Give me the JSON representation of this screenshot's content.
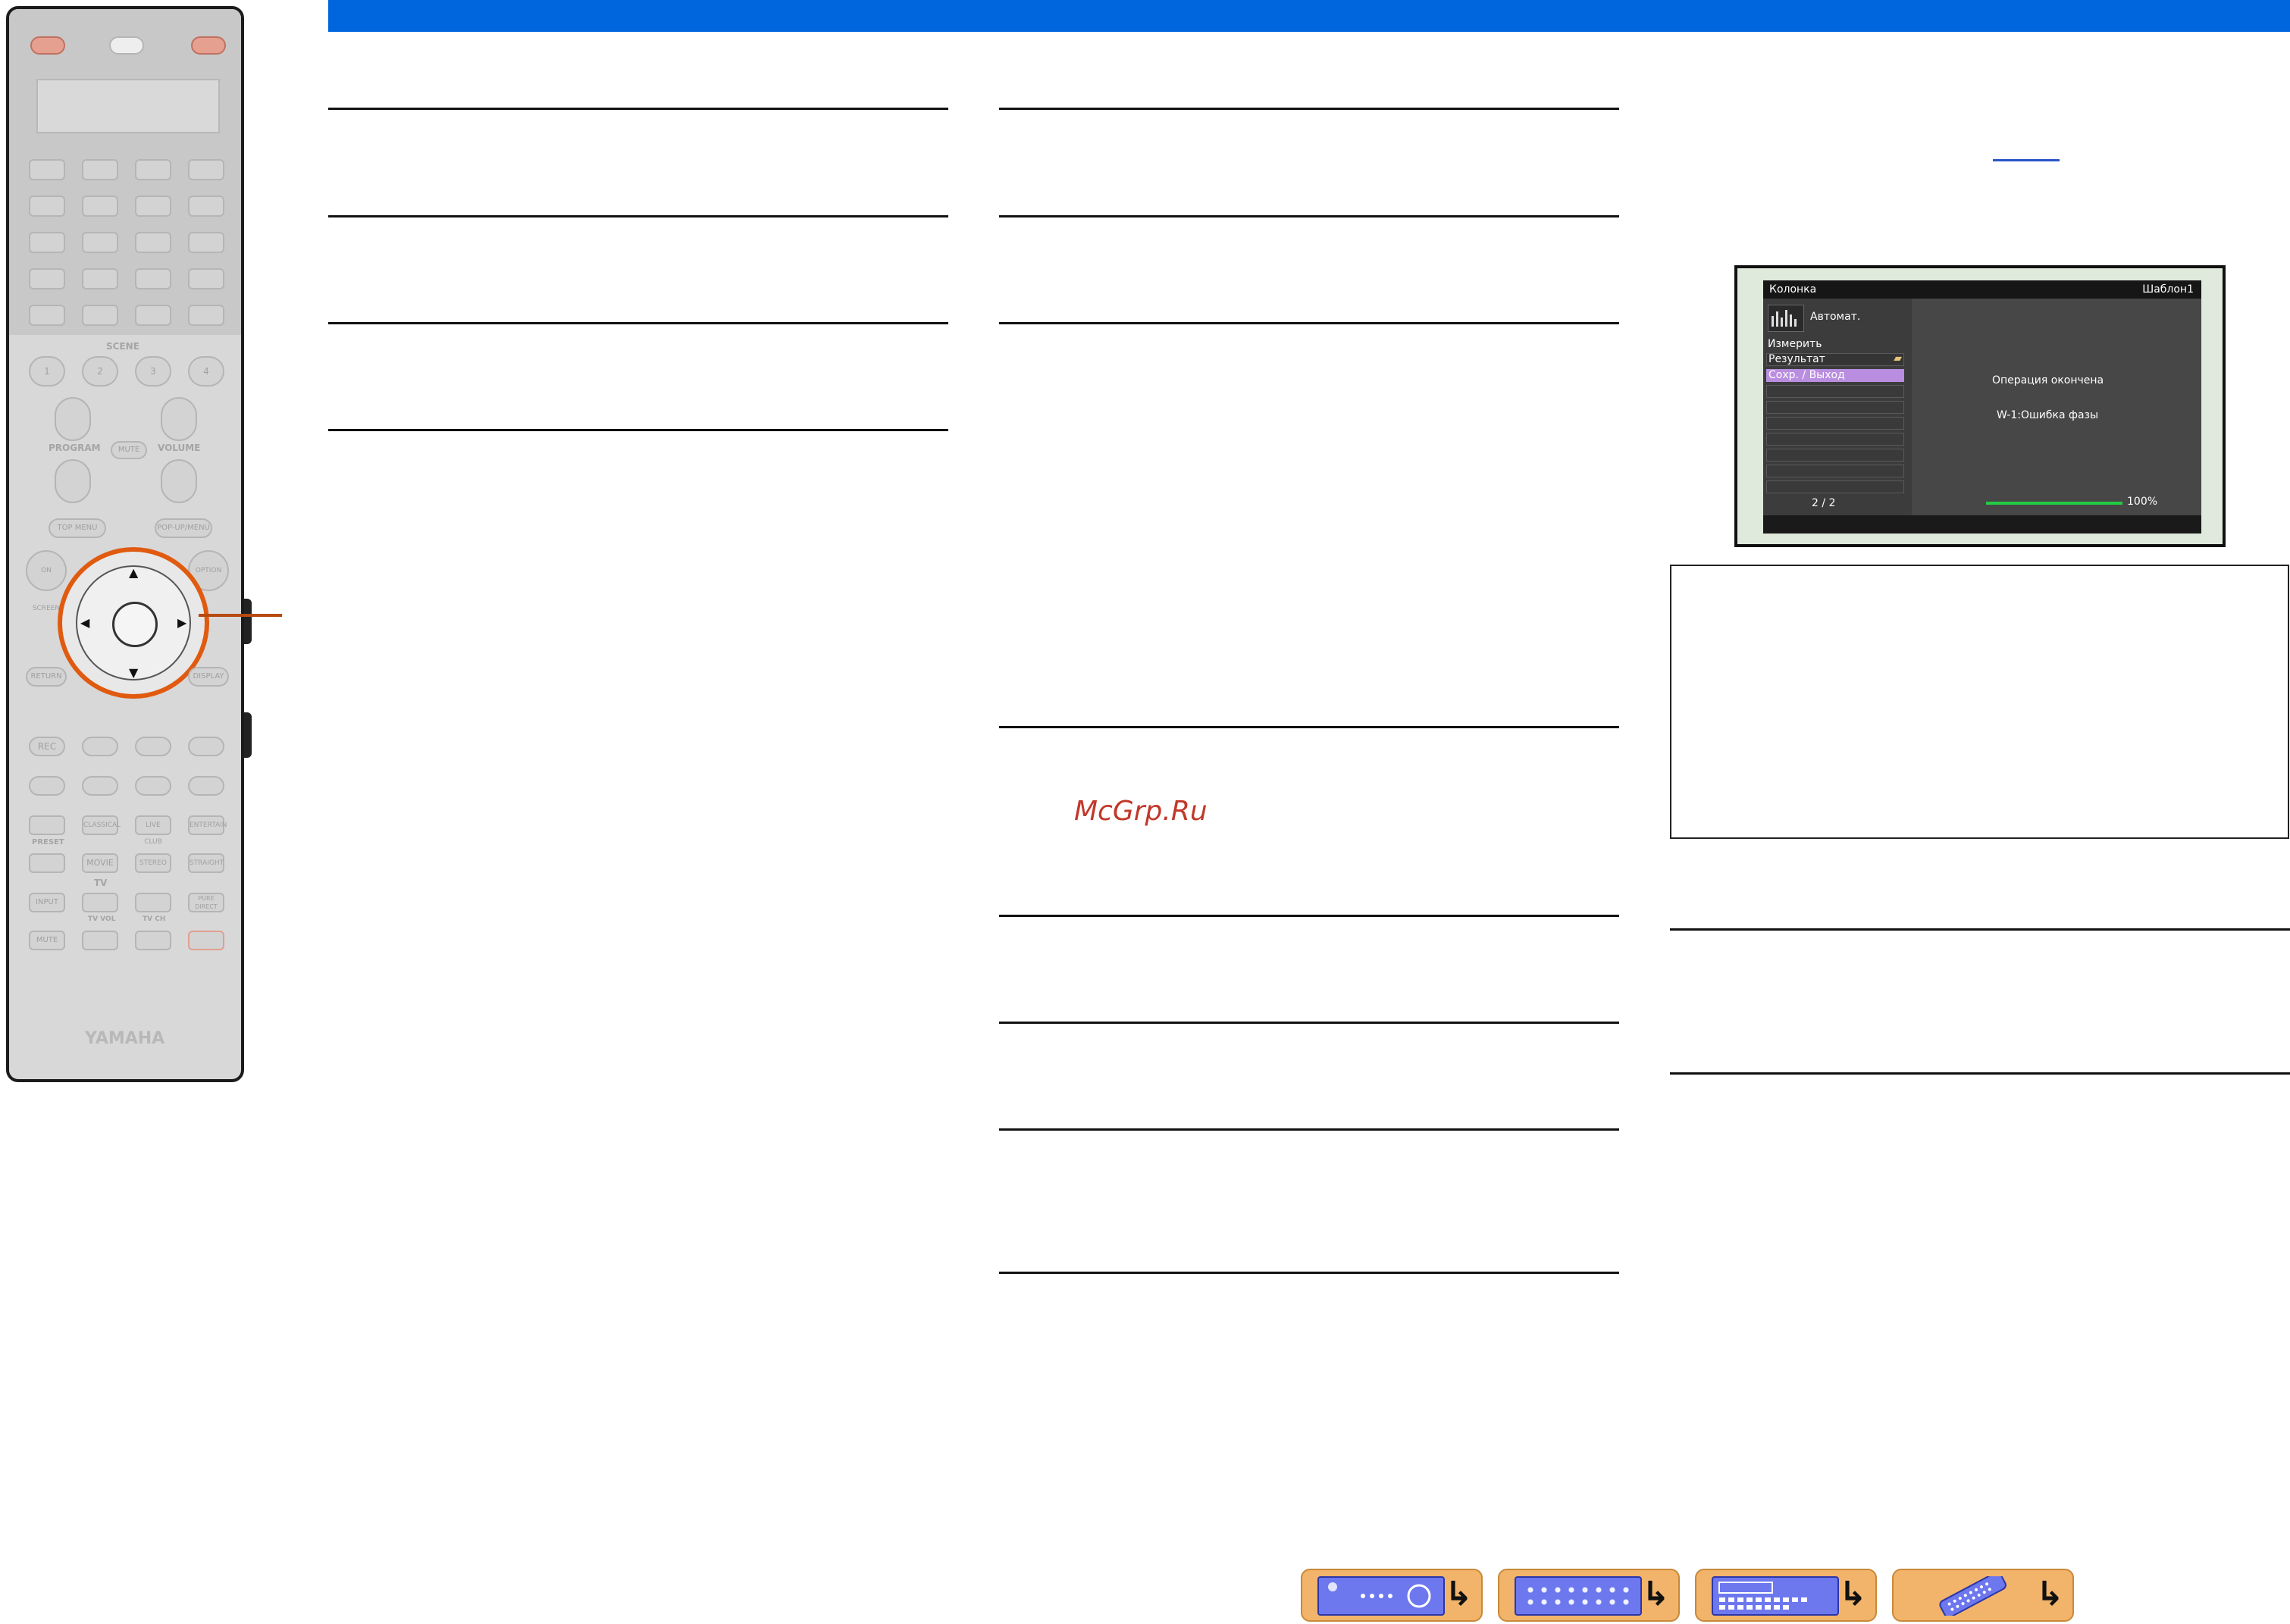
{
  "remote": {
    "scene_label": "SCENE",
    "scene_buttons": [
      "1",
      "2",
      "3",
      "4"
    ],
    "program_label": "PROGRAM",
    "volume_label": "VOLUME",
    "mute_small": "MUTE",
    "top_menu": "TOP MENU",
    "popup_menu": "POP-UP/MENU",
    "on_screen": "ON SCREEN",
    "option": "OPTION",
    "return": "RETURN",
    "display": "DISPLAY",
    "rec": "REC",
    "preset": "PRESET",
    "classical": "CLASSICAL",
    "live_club": "LIVE CLUB",
    "entertain": "ENTERTAIN",
    "movie": "MOVIE",
    "stereo": "STEREO",
    "straight": "STRAIGHT",
    "tv_label": "TV",
    "input": "INPUT",
    "tv_vol": "TV VOL",
    "tv_ch": "TV CH",
    "pure_direct": "PURE DIRECT",
    "mute": "MUTE",
    "brand": "YAMAHA"
  },
  "osd": {
    "title_left": "Колонка",
    "title_right": "Шаблон1",
    "mode": "Автомат.",
    "menu_measure": "Измерить",
    "menu_result": "Результат",
    "menu_save_exit": "Сохр. / Выход",
    "page": "2 / 2",
    "status_done": "Операция окончена",
    "status_error": "W-1:Ошибка фазы",
    "progress_text": "100%",
    "progress_value": 100,
    "colors": {
      "highlight": "#b98ee0",
      "progress": "#22cc44"
    }
  },
  "watermark": "McGrp.Ru",
  "nav_icons": [
    "receiver-front-icon",
    "receiver-rear-icon",
    "receiver-display-icon",
    "remote-control-icon"
  ]
}
